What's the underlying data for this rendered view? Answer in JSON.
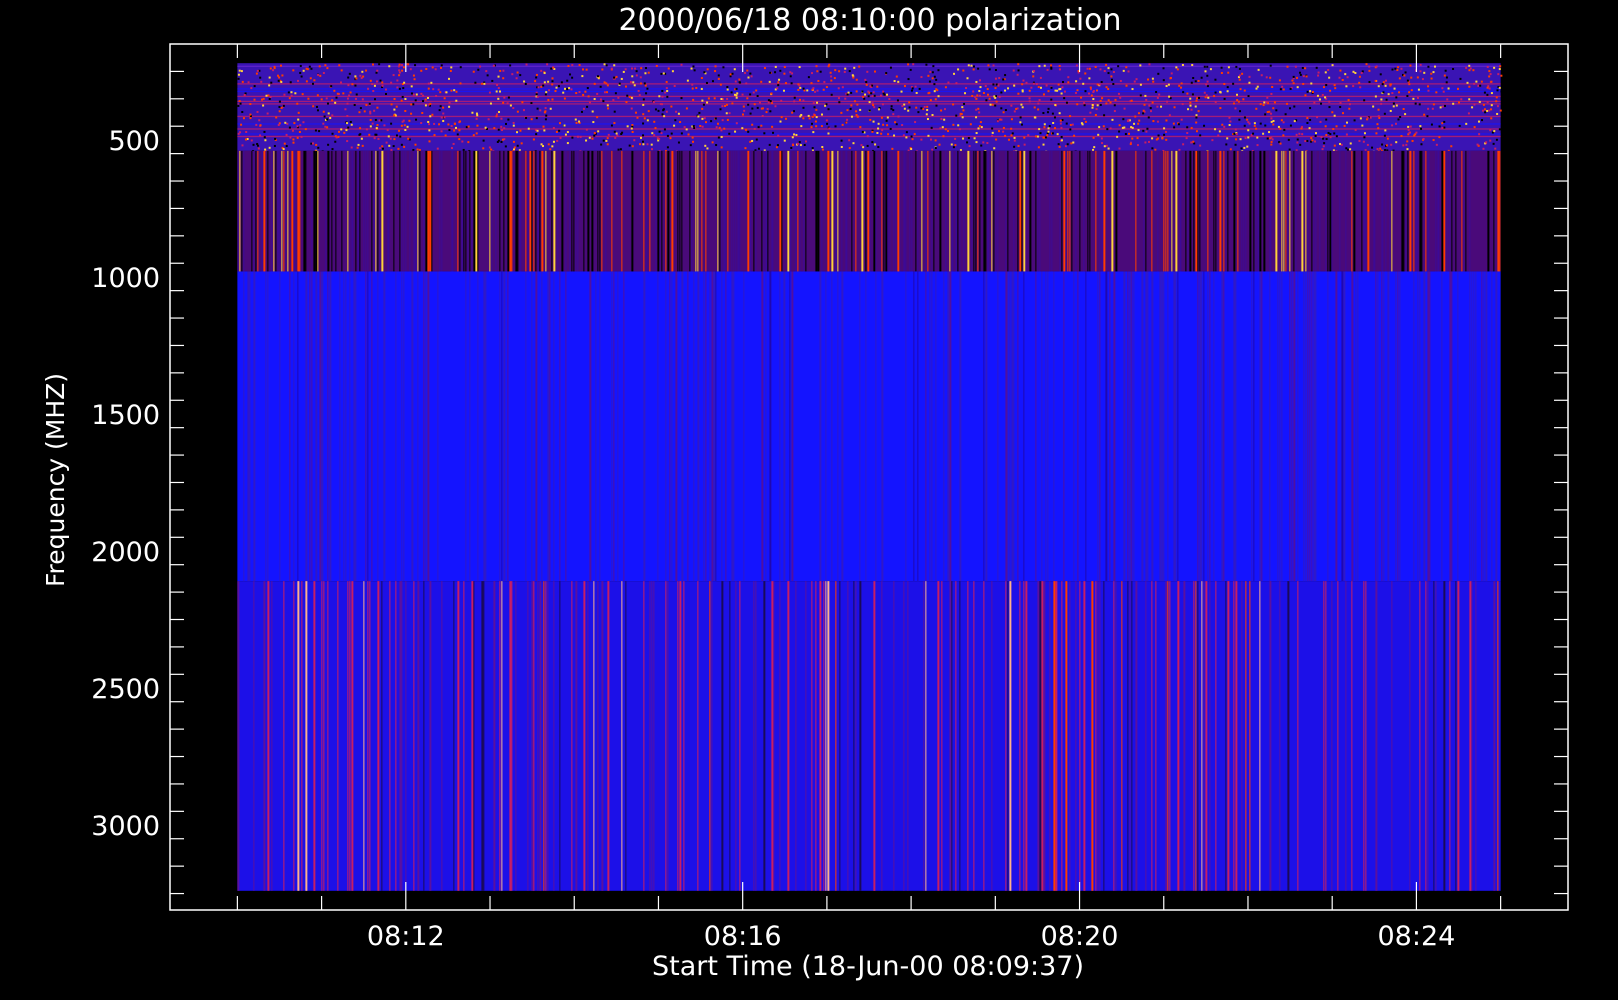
{
  "chart_data": {
    "type": "heatmap",
    "title": "2000/06/18 08:10:00 polarization",
    "xlabel": "Start Time (18-Jun-00 08:09:37)",
    "ylabel": "Frequency (MHZ)",
    "x_ticks": [
      "08:12",
      "08:16",
      "08:20",
      "08:24"
    ],
    "x_tick_minutes": [
      12,
      16,
      20,
      24
    ],
    "x_range_minutes": [
      9.2,
      25.8
    ],
    "data_x_range_minutes": [
      10.0,
      25.0
    ],
    "y_ticks": [
      500,
      1000,
      1500,
      2000,
      2500,
      3000
    ],
    "y_range": [
      3310,
      150
    ],
    "y_inverted": true,
    "bands": [
      {
        "freq_range": [
          220,
          540
        ],
        "pattern": "speckled",
        "base_color": "#3a14b4"
      },
      {
        "freq_range": [
          540,
          980
        ],
        "pattern": "streaks",
        "base_color": "#4a0a7a"
      },
      {
        "freq_range": [
          980,
          2110
        ],
        "pattern": "streaks",
        "base_color": "#1414ff"
      },
      {
        "freq_range": [
          2110,
          3240
        ],
        "pattern": "streaks",
        "base_color": "#1c10e8"
      }
    ],
    "colors": {
      "background": "#000000",
      "axes": "#ffffff",
      "palette": [
        "#000000",
        "#5a0090",
        "#1414ff",
        "#c81e64",
        "#ff3c00",
        "#ffd23c"
      ]
    },
    "grid": false
  }
}
